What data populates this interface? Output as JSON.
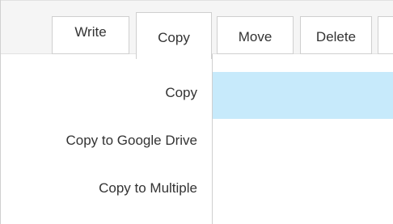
{
  "toolbar": {
    "buttons": [
      {
        "label": "Write"
      },
      {
        "label": "Copy"
      },
      {
        "label": "Move"
      },
      {
        "label": "Delete"
      }
    ]
  },
  "copy_menu": {
    "items": [
      {
        "label": "Copy"
      },
      {
        "label": "Copy to Google Drive"
      },
      {
        "label": "Copy to Multiple"
      }
    ]
  },
  "colors": {
    "toolbar_bg": "#f5f5f5",
    "selection_highlight": "#c7eafb",
    "border": "#cfcfcf",
    "text": "#333333"
  }
}
